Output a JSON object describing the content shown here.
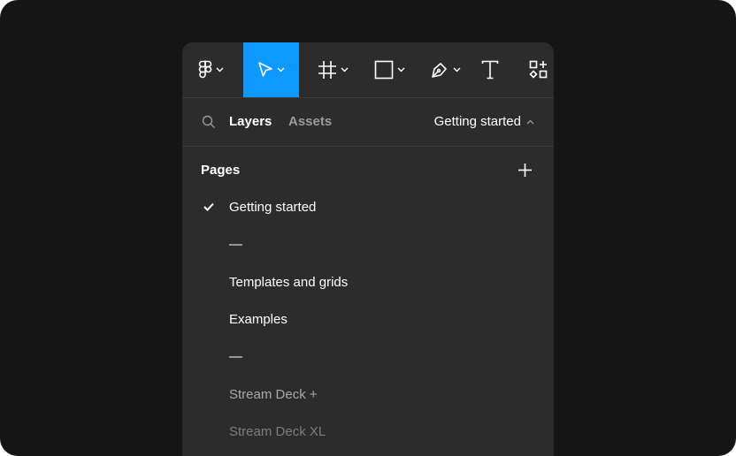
{
  "colors": {
    "background": "#151515",
    "panel": "#2c2c2c",
    "accent": "#0d99ff",
    "divider": "#3d3d3d"
  },
  "toolbar": {
    "tools": [
      {
        "name": "main-menu",
        "icon": "figma-logo-icon",
        "has_dropdown": true,
        "active": false
      },
      {
        "name": "move",
        "icon": "cursor-arrow-icon",
        "has_dropdown": true,
        "active": true
      },
      {
        "name": "frame",
        "icon": "frame-hash-icon",
        "has_dropdown": true,
        "active": false
      },
      {
        "name": "shape",
        "icon": "rectangle-icon",
        "has_dropdown": true,
        "active": false
      },
      {
        "name": "pen",
        "icon": "pen-nib-icon",
        "has_dropdown": true,
        "active": false
      },
      {
        "name": "text",
        "icon": "text-t-icon",
        "has_dropdown": false,
        "active": false
      },
      {
        "name": "resources",
        "icon": "shapes-plus-icon",
        "has_dropdown": false,
        "active": false
      }
    ]
  },
  "tabs": {
    "layers": "Layers",
    "assets": "Assets",
    "current_page": "Getting started"
  },
  "pages": {
    "header": "Pages",
    "items": [
      {
        "label": "Getting started",
        "selected": true
      },
      {
        "label": "—",
        "selected": false
      },
      {
        "label": "Templates and grids",
        "selected": false
      },
      {
        "label": "Examples",
        "selected": false
      },
      {
        "label": "—",
        "selected": false
      },
      {
        "label": "Stream Deck +",
        "selected": false
      },
      {
        "label": "Stream Deck XL",
        "selected": false
      }
    ]
  }
}
